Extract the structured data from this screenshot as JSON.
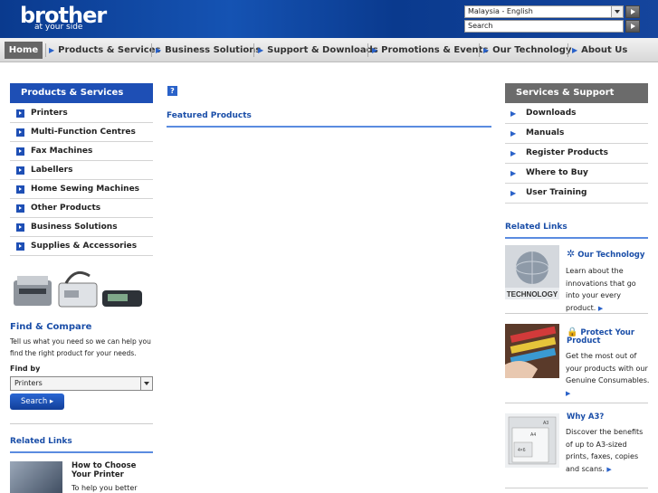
{
  "header": {
    "logo": "brother",
    "tagline": "at your side",
    "country_select": "Malaysia - English",
    "search_value": "Search"
  },
  "nav": {
    "items": [
      "Home",
      "Products & Services",
      "Business Solutions",
      "Support & Downloads",
      "Promotions & Events",
      "Our Technology",
      "About Us"
    ]
  },
  "left": {
    "title": "Products & Services",
    "items": [
      "Printers",
      "Multi-Function Centres",
      "Fax Machines",
      "Labellers",
      "Home Sewing Machines",
      "Other Products",
      "Business Solutions",
      "Supplies & Accessories"
    ],
    "find_compare": {
      "title": "Find & Compare",
      "desc": "Tell us what you need so we can help you find the right product for your needs.",
      "find_by": "Find by",
      "selected": "Printers",
      "button": "Search"
    },
    "related_links": {
      "title": "Related Links",
      "item_title": "How to Choose Your Printer",
      "item_desc": "To help you better find"
    }
  },
  "center": {
    "help_icon": "?",
    "featured": "Featured Products"
  },
  "right": {
    "title": "Services & Support",
    "items": [
      "Downloads",
      "Manuals",
      "Register Products",
      "Where to Buy",
      "User Training"
    ],
    "related_title": "Related Links",
    "cards": [
      {
        "title": "Our Technology",
        "desc": "Learn about the innovations that go into your every product.",
        "image_label": "TECHNOLOGY"
      },
      {
        "title": "Protect Your Product",
        "desc": "Get the most out of your products with our Genuine Consumables."
      },
      {
        "title": "Why A3?",
        "desc": "Discover the benefits of up to A3-sized prints, faxes, copies and scans.",
        "image_labels": [
          "A3",
          "A4",
          "4×6"
        ]
      }
    ]
  },
  "colors": {
    "brand_blue": "#0a3a8e",
    "link_blue": "#1a4ea8",
    "accent": "#2a62c9"
  }
}
